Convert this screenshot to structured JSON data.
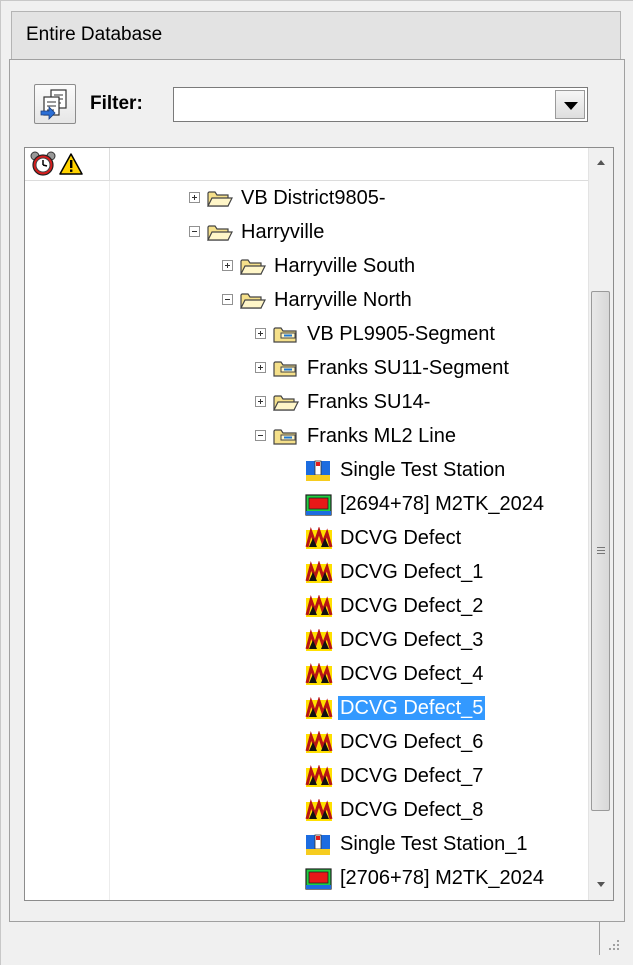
{
  "window": {
    "title": "Entire Database"
  },
  "toolbar": {
    "filter_label": "Filter:",
    "filter_value": ""
  },
  "tree": {
    "header_icons": [
      "alarm-clock-icon",
      "warning-icon"
    ],
    "selected_item": "DCVG Defect_5",
    "rows": [
      {
        "label": "VB District9805-",
        "icon": "folder-icon",
        "expander": "plus"
      },
      {
        "label": "Harryville",
        "icon": "folder-icon",
        "expander": "minus"
      },
      {
        "label": "Harryville South",
        "icon": "folder-icon",
        "expander": "plus"
      },
      {
        "label": "Harryville North",
        "icon": "folder-icon",
        "expander": "minus"
      },
      {
        "label": "VB PL9905-Segment",
        "icon": "pipeline-segment-icon",
        "expander": "plus"
      },
      {
        "label": "Franks SU11-Segment",
        "icon": "pipeline-segment-icon",
        "expander": "plus"
      },
      {
        "label": "Franks SU14-",
        "icon": "folder-icon",
        "expander": "plus"
      },
      {
        "label": "Franks ML2 Line",
        "icon": "pipeline-segment-icon",
        "expander": "minus"
      },
      {
        "label": "Single Test Station",
        "icon": "test-station-icon",
        "expander": "none"
      },
      {
        "label": "[2694+78] M2TK_2024",
        "icon": "rectifier-icon",
        "expander": "none"
      },
      {
        "label": "DCVG Defect",
        "icon": "dcvg-defect-icon",
        "expander": "none"
      },
      {
        "label": "DCVG Defect_1",
        "icon": "dcvg-defect-icon",
        "expander": "none"
      },
      {
        "label": "DCVG Defect_2",
        "icon": "dcvg-defect-icon",
        "expander": "none"
      },
      {
        "label": "DCVG Defect_3",
        "icon": "dcvg-defect-icon",
        "expander": "none"
      },
      {
        "label": "DCVG Defect_4",
        "icon": "dcvg-defect-icon",
        "expander": "none"
      },
      {
        "label": "DCVG Defect_5",
        "icon": "dcvg-defect-icon",
        "expander": "none"
      },
      {
        "label": "DCVG Defect_6",
        "icon": "dcvg-defect-icon",
        "expander": "none"
      },
      {
        "label": "DCVG Defect_7",
        "icon": "dcvg-defect-icon",
        "expander": "none"
      },
      {
        "label": "DCVG Defect_8",
        "icon": "dcvg-defect-icon",
        "expander": "none"
      },
      {
        "label": "Single Test Station_1",
        "icon": "test-station-icon",
        "expander": "none"
      },
      {
        "label": "[2706+78] M2TK_2024",
        "icon": "rectifier-icon",
        "expander": "none"
      }
    ]
  },
  "colors": {
    "selection": "#3399ff",
    "folder": "#f5e08a",
    "warning": "#ffd200",
    "defect_bg": "#ffe000",
    "rectifier_red": "#e81818",
    "rectifier_green": "#1fcf3f"
  }
}
